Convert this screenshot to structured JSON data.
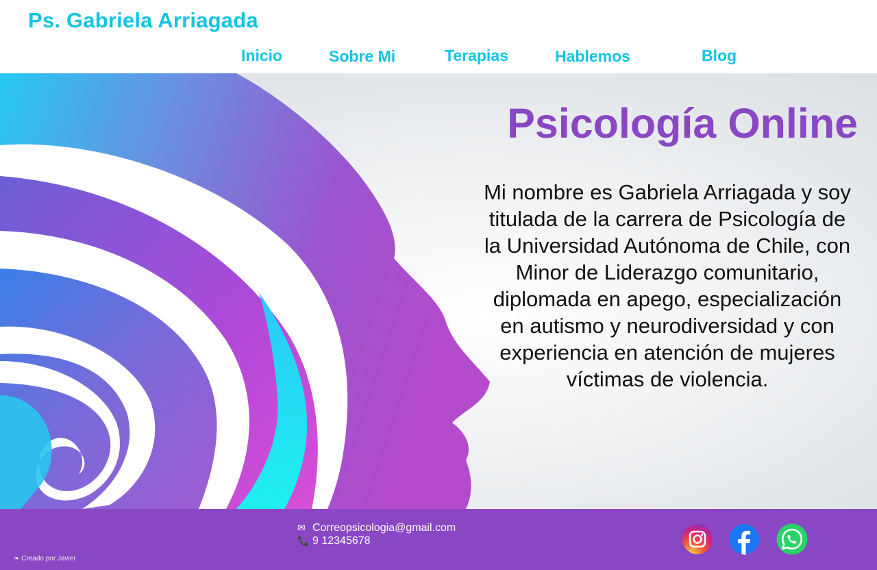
{
  "header": {
    "brand": "Ps. Gabriela Arriagada",
    "nav": [
      "Inicio",
      "Sobre Mi",
      "Terapias",
      "Hablemos",
      "Blog"
    ]
  },
  "hero": {
    "title": "Psicología Online",
    "description": "Mi nombre es Gabriela Arriagada y soy titulada de la carrera de Psicología de la Universidad Autónoma de Chile, con Minor de Liderazgo comunitario, diplomada en apego, especialización en autismo y neurodiversidad y con experiencia en atención de mujeres víctimas de violencia.",
    "image": "head-spiral-illustration"
  },
  "footer": {
    "email_icon": "envelope-icon",
    "email": "Correopsicologia@gmail.com",
    "phone_icon": "phone-icon",
    "phone": "9 12345678",
    "credit": "Creado por Javier",
    "social": [
      "instagram-icon",
      "facebook-icon",
      "whatsapp-icon"
    ]
  },
  "colors": {
    "accent": "#12c4e3",
    "purple": "#8a47c4"
  }
}
